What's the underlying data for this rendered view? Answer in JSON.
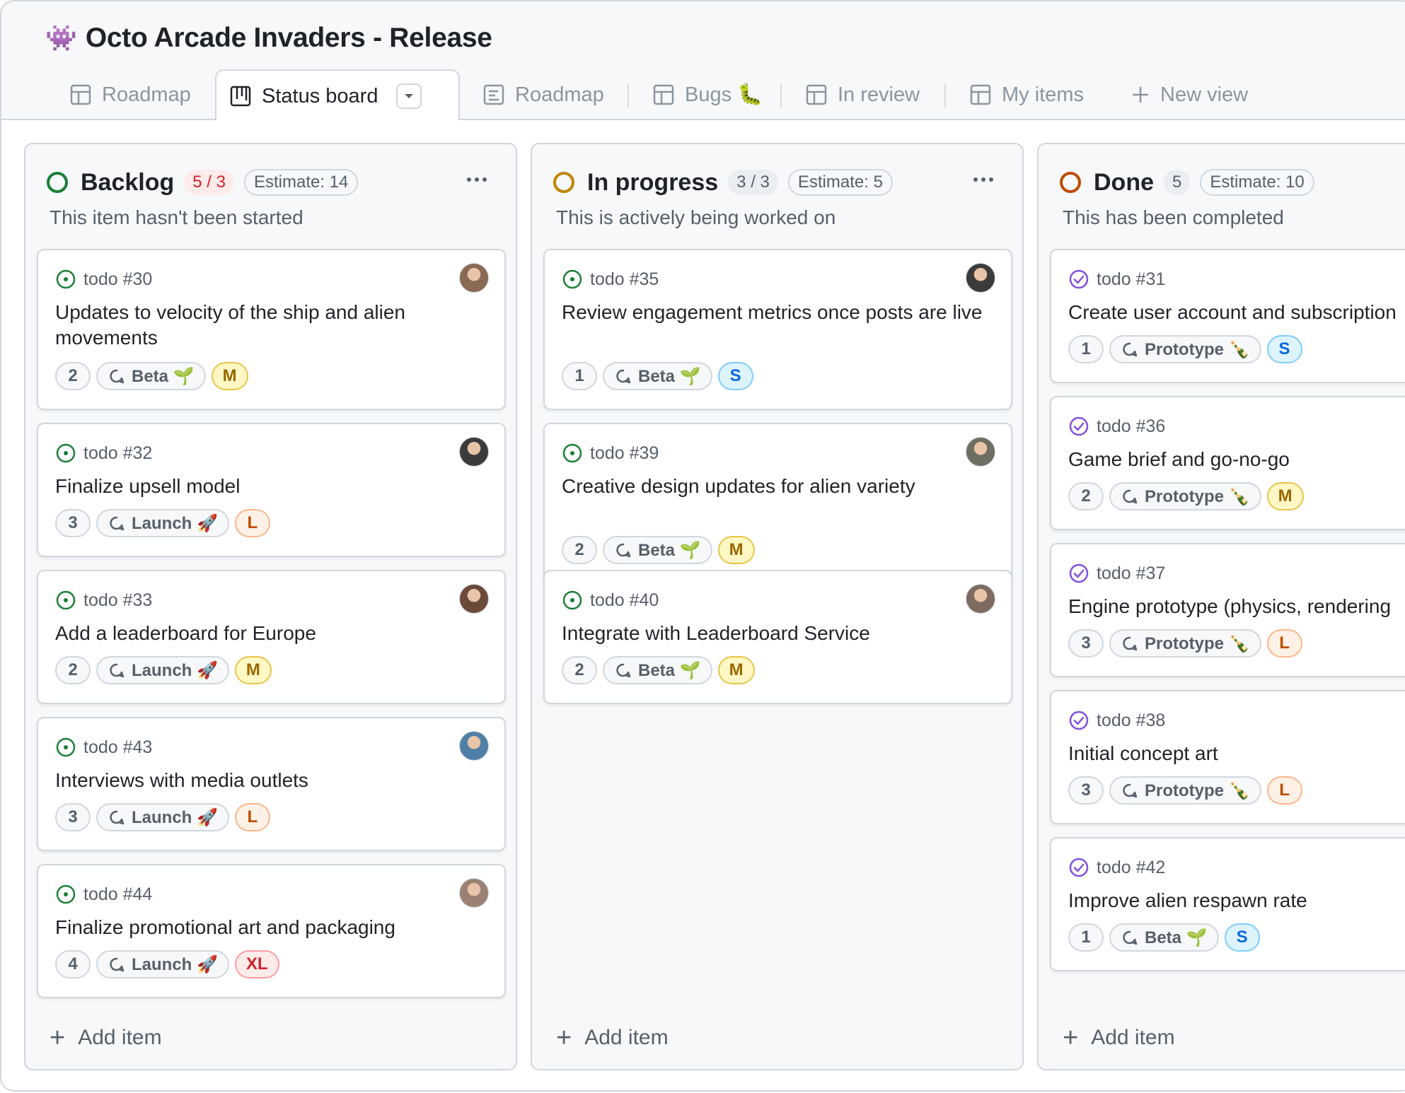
{
  "project": {
    "icon": "👾",
    "title": "Octo Arcade Invaders - Release"
  },
  "tabs": [
    {
      "label": "Roadmap",
      "icon": "table-icon"
    },
    {
      "label": "Status board",
      "icon": "board-icon",
      "active": true
    },
    {
      "label": "Roadmap",
      "icon": "roadmap-icon"
    },
    {
      "label": "Bugs 🐛",
      "icon": "table-icon"
    },
    {
      "label": "In review",
      "icon": "table-icon"
    },
    {
      "label": "My items",
      "icon": "table-icon"
    },
    {
      "label": "New view",
      "icon": "plus-icon"
    }
  ],
  "columns": [
    {
      "name": "Backlog",
      "count": "5 / 3",
      "estimate": "Estimate: 14",
      "description": "This item hasn't been started",
      "status_color": "#1a7f37",
      "add_label": "Add item",
      "cards": [
        {
          "num": "todo #30",
          "title": "Updates to velocity of the ship and alien movements",
          "points": "2",
          "iteration": "Beta 🌱",
          "size": "M",
          "avatar": "#8a6a55"
        },
        {
          "num": "todo #32",
          "title": "Finalize upsell model",
          "points": "3",
          "iteration": "Launch 🚀",
          "size": "L",
          "avatar": "#3b3b3b"
        },
        {
          "num": "todo #33",
          "title": "Add a leaderboard for Europe",
          "points": "2",
          "iteration": "Launch 🚀",
          "size": "M",
          "avatar": "#6b4a3a"
        },
        {
          "num": "todo #43",
          "title": "Interviews with media outlets",
          "points": "3",
          "iteration": "Launch 🚀",
          "size": "L",
          "avatar": "#4f7fa6"
        },
        {
          "num": "todo #44",
          "title": "Finalize promotional art and packaging",
          "points": "4",
          "iteration": "Launch 🚀",
          "size": "XL",
          "avatar": "#9b8173"
        }
      ]
    },
    {
      "name": "In progress",
      "count": "3 / 3",
      "estimate": "Estimate: 5",
      "description": "This is actively being worked on",
      "status_color": "#bf8700",
      "add_label": "Add item",
      "cards": [
        {
          "num": "todo #35",
          "title": "Review engagement metrics once posts are live",
          "points": "1",
          "iteration": "Beta 🌱",
          "size": "S",
          "avatar": "#3b3b3b"
        },
        {
          "num": "todo #39",
          "title": "Creative design updates for alien variety",
          "points": "2",
          "iteration": "Beta 🌱",
          "size": "M",
          "avatar": "#6e6e62"
        },
        {
          "num": "todo #40",
          "title": "Integrate with Leaderboard Service",
          "points": "2",
          "iteration": "Beta 🌱",
          "size": "M",
          "avatar": "#7d6a60"
        }
      ]
    },
    {
      "name": "Done",
      "count": "5",
      "estimate": "Estimate: 10",
      "description": "This has been completed",
      "status_color": "#bc4c00",
      "add_label": "Add item",
      "cards": [
        {
          "num": "todo #31",
          "title": "Create user account and subscription",
          "points": "1",
          "iteration": "Prototype 🍾",
          "size": "S"
        },
        {
          "num": "todo #36",
          "title": "Game brief and go-no-go",
          "points": "2",
          "iteration": "Prototype 🍾",
          "size": "M"
        },
        {
          "num": "todo #37",
          "title": "Engine prototype (physics, rendering",
          "points": "3",
          "iteration": "Prototype 🍾",
          "size": "L"
        },
        {
          "num": "todo #38",
          "title": "Initial concept art",
          "points": "3",
          "iteration": "Prototype 🍾",
          "size": "L"
        },
        {
          "num": "todo #42",
          "title": "Improve alien respawn rate",
          "points": "1",
          "iteration": "Beta 🌱",
          "size": "S"
        }
      ]
    }
  ],
  "colors": {
    "open": "#1a7f37",
    "done": "#8250df",
    "size_S": "#0969da",
    "size_M": "#9a6700",
    "size_L": "#bc4c00",
    "size_XL": "#cf222e",
    "over_limit": "#cf222e"
  }
}
